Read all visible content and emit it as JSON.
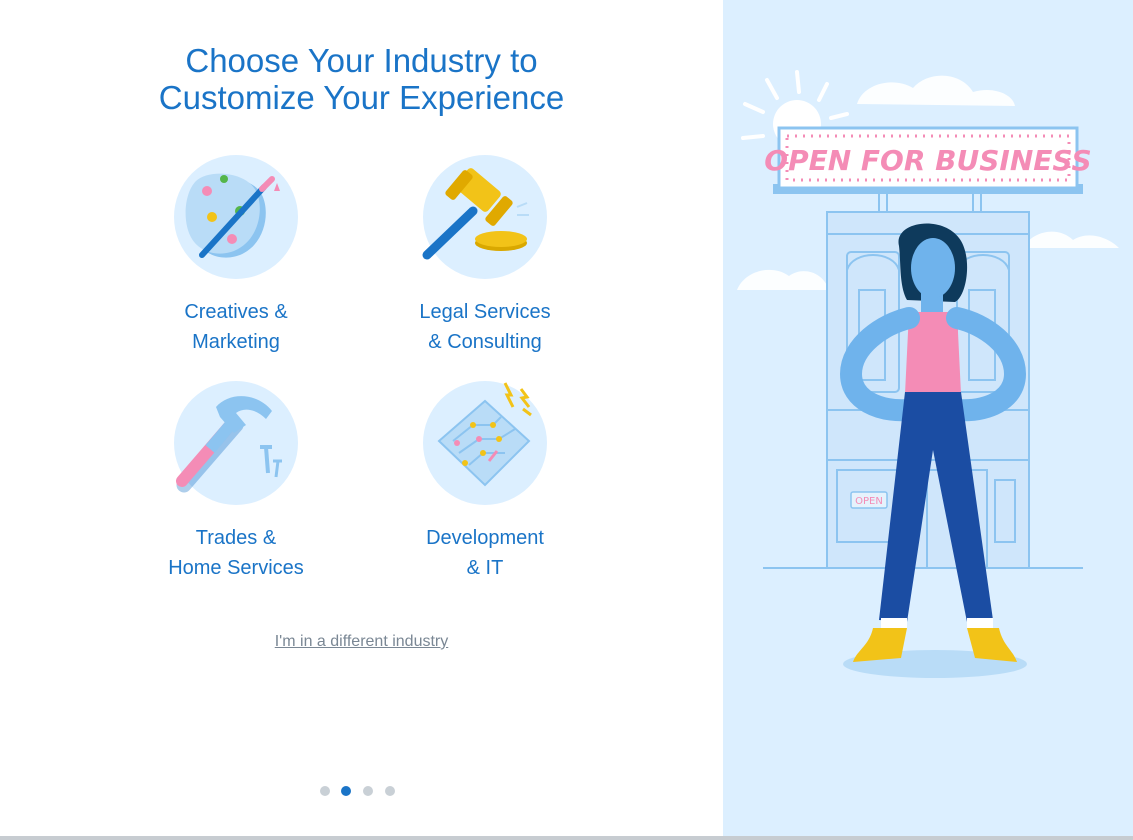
{
  "title": {
    "line1": "Choose Your Industry to",
    "line2": "Customize Your Experience"
  },
  "industries": [
    {
      "line1": "Creatives &",
      "line2": "Marketing",
      "icon": "palette-icon"
    },
    {
      "line1": "Legal Services",
      "line2": "& Consulting",
      "icon": "gavel-icon"
    },
    {
      "line1": "Trades &",
      "line2": "Home Services",
      "icon": "hammer-icon"
    },
    {
      "line1": "Development",
      "line2": "& IT",
      "icon": "circuit-board-icon"
    }
  ],
  "different_industry_link": "I'm in a different industry",
  "pagination": {
    "total": 4,
    "active": 2
  },
  "illustration": {
    "sign_text": "OPEN FOR BUSINESS",
    "door_sign_text": "OPEN"
  },
  "colors": {
    "primary": "#1a74c7",
    "panel_bg": "#dcefff",
    "accent_pink": "#f48cb6",
    "accent_yellow": "#f2c318"
  }
}
